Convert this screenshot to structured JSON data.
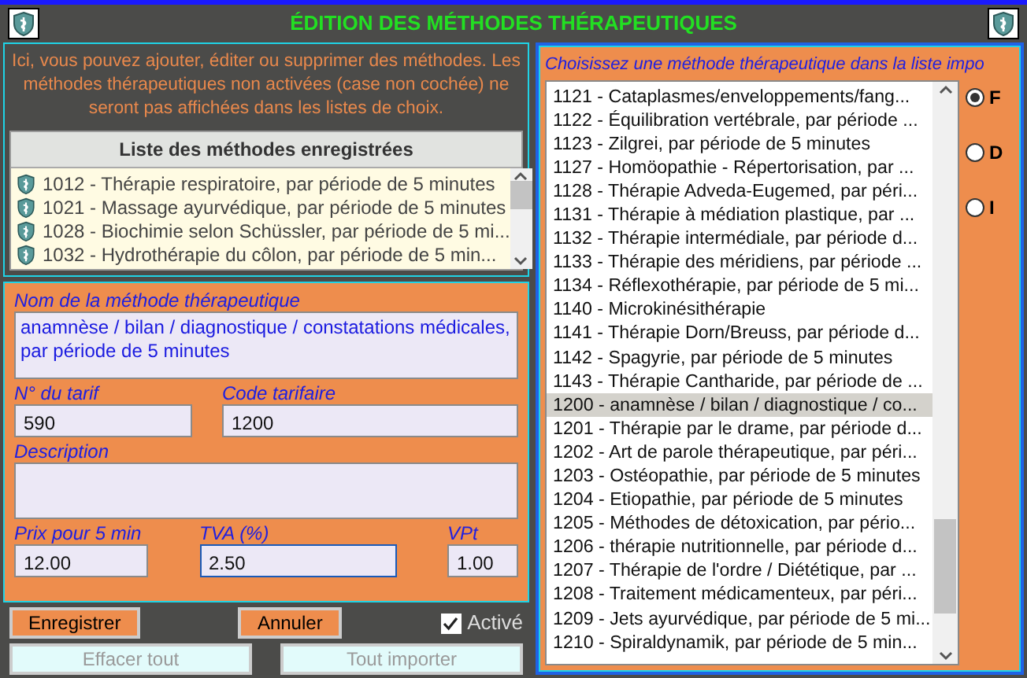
{
  "window": {
    "title": "ÉDITION DES MÉTHODES THÉRAPEUTIQUES"
  },
  "info_text": "Ici, vous pouvez ajouter, éditer ou supprimer des méthodes. Les méthodes thérapeutiques non activées (case non cochée) ne seront pas affichées dans les listes de choix.",
  "saved_list": {
    "header": "Liste des méthodes enregistrées",
    "items": [
      {
        "label": "1012 - Thérapie respiratoire, par période de 5 minutes"
      },
      {
        "label": "1021 - Massage ayurvédique, par période de 5 minutes"
      },
      {
        "label": "1028 - Biochimie selon Schüssler, par période de 5 mi..."
      },
      {
        "label": "1032 - Hydrothérapie du côlon, par période de 5 min..."
      }
    ]
  },
  "form": {
    "fields": [
      {
        "label": "Nom de la méthode thérapeutique",
        "value": "anamnèse / bilan / diagnostique / constatations médicales, par période de 5 minutes",
        "kind": "textarea"
      },
      {
        "label": "N° du tarif",
        "value": "590",
        "kind": "input"
      },
      {
        "label": "Code tarifaire",
        "value": "1200",
        "kind": "input"
      },
      {
        "label": "Description",
        "kind": "textarea"
      },
      {
        "label": "Prix pour 5 min",
        "value": "12.00",
        "kind": "input"
      },
      {
        "label": "TVA (%)",
        "value": "2.50",
        "kind": "input",
        "focused": true
      },
      {
        "label": "VPt",
        "value": "1.00",
        "kind": "input"
      }
    ]
  },
  "buttons": [
    {
      "label": "Enregistrer",
      "disabled": false
    },
    {
      "label": "Annuler",
      "disabled": false
    },
    {
      "label": "Effacer tout",
      "disabled": true
    },
    {
      "label": "Tout importer",
      "disabled": true
    }
  ],
  "activated": {
    "label": "Activé",
    "checked": true
  },
  "import_list": {
    "label": "Choisissez une méthode thérapeutique dans la liste impo",
    "items": [
      {
        "label": "1121 - Cataplasmes/enveloppements/fang...",
        "selected": false
      },
      {
        "label": "1122 - Équilibration vertébrale, par période ...",
        "selected": false
      },
      {
        "label": "1123 - Zilgrei, par période de 5 minutes",
        "selected": false
      },
      {
        "label": "1127 - Homöopathie - Répertorisation, par ...",
        "selected": false
      },
      {
        "label": "1128 - Thérapie Adveda-Eugemed, par péri...",
        "selected": false
      },
      {
        "label": "1131 - Thérapie à médiation plastique, par ...",
        "selected": false
      },
      {
        "label": "1132 - Thérapie intermédiale, par période d...",
        "selected": false
      },
      {
        "label": "1133 - Thérapie des méridiens, par période ...",
        "selected": false
      },
      {
        "label": "1134 - Réflexothérapie, par période de 5 mi...",
        "selected": false
      },
      {
        "label": "1140 - Microkinésithérapie",
        "selected": false
      },
      {
        "label": "1141 - Thérapie Dorn/Breuss,  par période d...",
        "selected": false
      },
      {
        "label": "1142 - Spagyrie,  par période de 5 minutes",
        "selected": false
      },
      {
        "label": "1143 - Thérapie Cantharide, par période de ...",
        "selected": false
      },
      {
        "label": "1200 - anamnèse / bilan / diagnostique / co...",
        "selected": true
      },
      {
        "label": "1201 - Thérapie par le drame, par période d...",
        "selected": false
      },
      {
        "label": "1202 - Art de parole thérapeutique, par péri...",
        "selected": false
      },
      {
        "label": "1203 - Ostéopathie, par période de 5 minutes",
        "selected": false
      },
      {
        "label": "1204 - Etiopathie, par période de 5 minutes",
        "selected": false
      },
      {
        "label": "1205 - Méthodes de détoxication, par pério...",
        "selected": false
      },
      {
        "label": "1206 - thérapie nutritionnelle, par période d...",
        "selected": false
      },
      {
        "label": "1207 - Thérapie de l'ordre / Diététique, par ...",
        "selected": false
      },
      {
        "label": "1208 - Traitement médicamenteux, par péri...",
        "selected": false
      },
      {
        "label": "1209 - Jets ayurvédique, par période de 5 mi...",
        "selected": false
      },
      {
        "label": "1210 - Spiraldynamik,  par période de 5 min...",
        "selected": false
      }
    ]
  },
  "list_type": [
    {
      "label": "F",
      "selected": true
    },
    {
      "label": "D",
      "selected": false
    },
    {
      "label": "I",
      "selected": false
    }
  ]
}
